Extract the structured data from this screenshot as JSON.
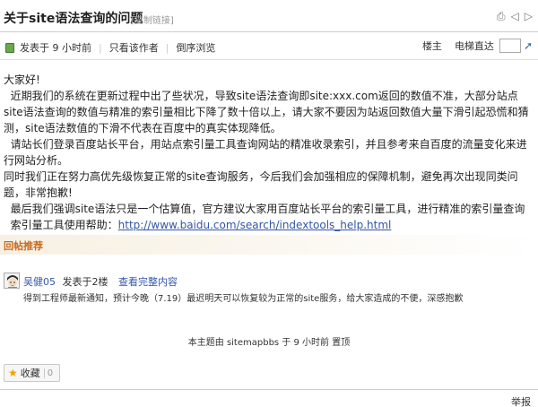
{
  "header": {
    "title": "关于site语法查询的问题",
    "copy_link": "[复制链接]"
  },
  "meta": {
    "posted": "发表于 9 小时前",
    "only_author": "只看该作者",
    "reverse_view": "倒序浏览",
    "floor_owner": "楼主",
    "elevator": "电梯直达"
  },
  "post": {
    "greeting": "大家好!",
    "p1": "近期我们的系统在更新过程中出了些状况，导致site语法查询即site:xxx.com返回的数值不准，大部分站点site语法查询的数值与精准的索引量相比下降了数十倍以上，请大家不要因为站返回数值大量下滑引起恐慌和猜测，site语法数值的下滑不代表在百度中的真实体现降低。",
    "p2": "请站长们登录百度站长平台，用站点索引量工具查询网站的精准收录索引，并且参考来自百度的流量变化来进行网站分析。",
    "p3": "同时我们正在努力高优先级恢复正常的site查询服务，今后我们会加强相应的保障机制，避免再次出现同类问题，非常抱歉!",
    "p4": "最后我们强调site语法只是一个估算值，官方建议大家用百度站长平台的索引量工具，进行精准的索引量查询",
    "p5_prefix": "索引量工具使用帮助：",
    "p5_link": "http://www.baidu.com/search/indextools_help.html"
  },
  "recommend": {
    "title": "回帖推荐"
  },
  "reply": {
    "author": "吴健05",
    "posted": "发表于2楼",
    "view_full": "查看完整内容",
    "text": "得到工程师最新通知，预计今晚（7.19）最迟明天可以恢复较为正常的site服务，给大家造成的不便，深感抱歉"
  },
  "footer": {
    "author_line": "本主题由 sitemapbbs 于 9 小时前 置顶",
    "fav_label": "收藏",
    "fav_count": "0",
    "report": "举报"
  },
  "icons": [
    "print-icon",
    "prev-icon",
    "next-icon",
    "online-status-icon",
    "go-icon",
    "avatar",
    "star-icon"
  ],
  "colors": {
    "link": "#3355aa",
    "recommend_title": "#c96a1c",
    "recommend_bg": "#f7f0e3"
  }
}
